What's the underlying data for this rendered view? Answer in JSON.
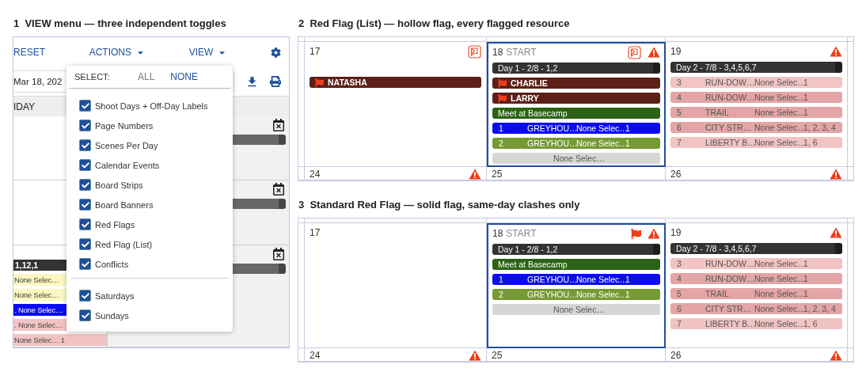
{
  "view_section": {
    "number": "1",
    "title": "VIEW menu — three independent toggles",
    "toolbar": [
      {
        "label": "RESET",
        "kind": "plain"
      },
      {
        "label": "ACTIONS",
        "kind": "menu"
      },
      {
        "label": "VIEW",
        "kind": "menu"
      }
    ],
    "date": "Mar 18, 202",
    "day_header": "IDAY",
    "rows": [
      {
        "events": []
      },
      {
        "events": []
      },
      {
        "events": [
          {
            "kind": "day",
            "text": "1,12,1"
          },
          {
            "kind": "chip",
            "text": "None Selec…",
            "color": "#fbf7bf"
          },
          {
            "kind": "chip",
            "text": "None Selec…",
            "color": "#fbf7bf"
          },
          {
            "kind": "chip",
            "text": ". None Selec…",
            "color": "#0a0af5"
          },
          {
            "kind": "chip",
            "text": ". None Selec…",
            "color": "#f2c3c3"
          },
          {
            "kind": "chip",
            "text": "None Selec… 1",
            "color": "#f2c3c3"
          }
        ]
      }
    ],
    "menu": {
      "select_label": "SELECT:",
      "all": {
        "label": "ALL",
        "disabled": true
      },
      "none": {
        "label": "NONE",
        "disabled": false
      },
      "groups": [
        [
          {
            "label": "Shoot Days + Off-Day Labels",
            "checked": true
          },
          {
            "label": "Page Numbers",
            "checked": true
          },
          {
            "label": "Scenes Per Day",
            "checked": true
          },
          {
            "label": "Calendar Events",
            "checked": true
          },
          {
            "label": "Board Strips",
            "checked": true
          },
          {
            "label": "Board Banners",
            "checked": true
          },
          {
            "label": "Red Flags",
            "checked": true
          },
          {
            "label": "Red Flag (List)",
            "checked": true
          },
          {
            "label": "Conflicts",
            "checked": true
          }
        ],
        [
          {
            "label": "Saturdays",
            "checked": true
          },
          {
            "label": "Sundays",
            "checked": true
          }
        ]
      ]
    }
  },
  "calendars": [
    {
      "number": "2",
      "title": "Red Flag (List) — hollow flag, every flagged resource",
      "weeks": [
        {
          "days": [
            {
              "date": "17",
              "flag_list": true,
              "red_flag": false,
              "conflict": false,
              "selected": false,
              "events": [
                {
                  "kind": "flag",
                  "text": "NATASHA"
                }
              ]
            },
            {
              "date": "18",
              "label": "START",
              "flag_list": true,
              "red_flag": false,
              "conflict": true,
              "selected": true,
              "events": [
                {
                  "kind": "day",
                  "text": "Day 1 - 2/8 - 1,2"
                },
                {
                  "kind": "flag",
                  "text": "CHARLIE"
                },
                {
                  "kind": "flag",
                  "text": "LARRY"
                },
                {
                  "kind": "event",
                  "text": "Meet at Basecamp"
                },
                {
                  "kind": "strip",
                  "number": "1",
                  "name": "GREYHOU…",
                  "set": "None Selec…",
                  "pages": "1",
                  "color": "#0a0af5"
                },
                {
                  "kind": "strip",
                  "number": "2",
                  "name": "GREYHOU…",
                  "set": "None Selec…",
                  "pages": "1",
                  "color": "#769a33"
                },
                {
                  "kind": "unassigned",
                  "text": "None Selec…"
                }
              ]
            },
            {
              "date": "19",
              "flag_list": false,
              "red_flag": false,
              "conflict": true,
              "selected": false,
              "events": [
                {
                  "kind": "day",
                  "text": "Day 2 - 7/8 - 3,4,5,6,7"
                },
                {
                  "kind": "strip",
                  "number": "3",
                  "name": "RUN-DOW…",
                  "set": "None Selec…",
                  "pages": "1",
                  "color": "#f2c3c3"
                },
                {
                  "kind": "strip",
                  "number": "4",
                  "name": "RUN-DOW…",
                  "set": "None Selec…",
                  "pages": "1",
                  "color": "#e3a5a5"
                },
                {
                  "kind": "strip",
                  "number": "5",
                  "name": "TRAIL",
                  "set": "None Selec…",
                  "pages": "1",
                  "color": "#e3a5a5"
                },
                {
                  "kind": "strip",
                  "number": "6",
                  "name": "CITY STR…",
                  "set": "None Selec…",
                  "pages": "1, 2, 3, 4",
                  "color": "#e3a5a5"
                },
                {
                  "kind": "strip",
                  "number": "7",
                  "name": "LIBERTY B…",
                  "set": "None Selec…",
                  "pages": "1, 6",
                  "color": "#f2c3c3"
                }
              ]
            }
          ]
        },
        {
          "days": [
            {
              "date": "24",
              "flag_list": false,
              "red_flag": false,
              "conflict": true,
              "selected": false
            },
            {
              "date": "25",
              "flag_list": false,
              "red_flag": false,
              "conflict": false,
              "selected": false
            },
            {
              "date": "26",
              "flag_list": false,
              "red_flag": false,
              "conflict": true,
              "selected": false
            }
          ]
        }
      ]
    },
    {
      "number": "3",
      "title": "Standard Red Flag — solid flag, same-day clashes only",
      "weeks": [
        {
          "days": [
            {
              "date": "17",
              "flag_list": false,
              "red_flag": false,
              "conflict": false,
              "selected": false
            },
            {
              "date": "18",
              "label": "START",
              "flag_list": false,
              "red_flag": true,
              "conflict": true,
              "selected": true,
              "events": [
                {
                  "kind": "day",
                  "text": "Day 1 - 2/8 - 1,2"
                },
                {
                  "kind": "event",
                  "text": "Meet at Basecamp"
                },
                {
                  "kind": "strip",
                  "number": "1",
                  "name": "GREYHOU…",
                  "set": "None Selec…",
                  "pages": "1",
                  "color": "#0a0af5"
                },
                {
                  "kind": "strip",
                  "number": "2",
                  "name": "GREYHOU…",
                  "set": "None Selec…",
                  "pages": "1",
                  "color": "#769a33"
                },
                {
                  "kind": "unassigned",
                  "text": "None Selec…"
                }
              ]
            },
            {
              "date": "19",
              "flag_list": false,
              "red_flag": false,
              "conflict": true,
              "selected": false,
              "events": [
                {
                  "kind": "day",
                  "text": "Day 2 - 7/8 - 3,4,5,6,7"
                },
                {
                  "kind": "strip",
                  "number": "3",
                  "name": "RUN-DOW…",
                  "set": "None Selec…",
                  "pages": "1",
                  "color": "#f2c3c3"
                },
                {
                  "kind": "strip",
                  "number": "4",
                  "name": "RUN-DOW…",
                  "set": "None Selec…",
                  "pages": "1",
                  "color": "#e3a5a5"
                },
                {
                  "kind": "strip",
                  "number": "5",
                  "name": "TRAIL",
                  "set": "None Selec…",
                  "pages": "1",
                  "color": "#e3a5a5"
                },
                {
                  "kind": "strip",
                  "number": "6",
                  "name": "CITY STR…",
                  "set": "None Selec…",
                  "pages": "1, 2, 3, 4",
                  "color": "#e3a5a5"
                },
                {
                  "kind": "strip",
                  "number": "7",
                  "name": "LIBERTY B…",
                  "set": "None Selec…",
                  "pages": "1, 6",
                  "color": "#f2c3c3"
                }
              ]
            }
          ]
        },
        {
          "days": [
            {
              "date": "24",
              "flag_list": false,
              "red_flag": false,
              "conflict": true,
              "selected": false
            },
            {
              "date": "25",
              "flag_list": false,
              "red_flag": false,
              "conflict": false,
              "selected": false
            },
            {
              "date": "26",
              "flag_list": false,
              "red_flag": false,
              "conflict": true,
              "selected": false
            }
          ]
        }
      ]
    }
  ]
}
